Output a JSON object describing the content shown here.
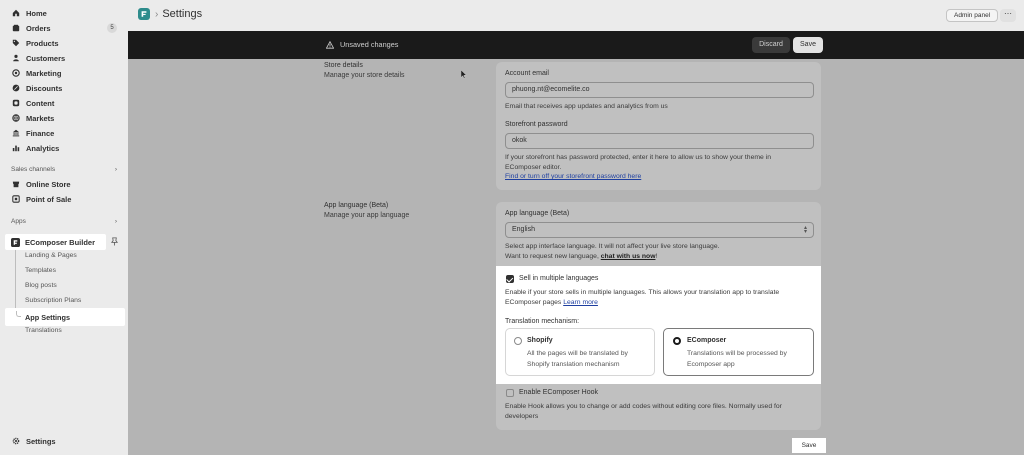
{
  "sidebar": {
    "items": [
      {
        "label": "Home",
        "icon": "home-icon"
      },
      {
        "label": "Orders",
        "icon": "orders-icon",
        "badge": "5"
      },
      {
        "label": "Products",
        "icon": "tag-icon"
      },
      {
        "label": "Customers",
        "icon": "person-icon"
      },
      {
        "label": "Marketing",
        "icon": "target-icon"
      },
      {
        "label": "Discounts",
        "icon": "discount-icon"
      },
      {
        "label": "Content",
        "icon": "content-icon"
      },
      {
        "label": "Markets",
        "icon": "globe-icon"
      },
      {
        "label": "Finance",
        "icon": "bank-icon"
      },
      {
        "label": "Analytics",
        "icon": "chart-icon"
      }
    ],
    "sales_channels_label": "Sales channels",
    "channels": [
      "Online Store",
      "Point of Sale"
    ],
    "apps_label": "Apps",
    "app_name": "EComposer Builder",
    "app_sub_items": [
      "Landing & Pages",
      "Templates",
      "Blog posts",
      "Subscription Plans"
    ],
    "active_sub_item": "App Settings",
    "after_active_sub_item": "Translations",
    "settings_label": "Settings"
  },
  "topbar": {
    "title": "Settings",
    "admin_panel": "Admin panel",
    "more": "⋯"
  },
  "unsaved_bar": {
    "message": "Unsaved changes",
    "discard": "Discard",
    "save": "Save"
  },
  "store_details": {
    "title": "Store details",
    "description": "Manage your store details",
    "account_email_label": "Account email",
    "account_email_value": "phuong.nt@ecomelite.co",
    "account_email_help": "Email that receives app updates and analytics from us",
    "storefront_password_label": "Storefront password",
    "storefront_password_value": "okok",
    "storefront_password_help_1": "If your storefront has password protected, enter it here to allow us to show your theme in",
    "storefront_password_help_2": "EComposer editor.",
    "storefront_password_link": "Find or turn off your storefront password here"
  },
  "app_language": {
    "title": "App language (Beta)",
    "description": "Manage your app language",
    "field_label": "App language (Beta)",
    "selected": "English",
    "help_1": "Select app interface language. It will not affect your live store language.",
    "help_2_prefix": "Want to request new language, ",
    "help_2_link": "chat with us now",
    "help_2_suffix": "!",
    "sell_multiple_label": "Sell in multiple languages",
    "sell_multiple_checked": true,
    "sell_multiple_help_1": "Enable if your store sells in multiple languages. This allows your translation app to translate",
    "sell_multiple_help_2_prefix": "EComposer pages ",
    "sell_multiple_learn_more": "Learn more",
    "mechanism_label": "Translation mechanism:",
    "options": [
      {
        "title": "Shopify",
        "desc_1": "All the pages will be translated by",
        "desc_2": "Shopify translation mechanism",
        "selected": false
      },
      {
        "title": "EComposer",
        "desc_1": "Translations will be processed by",
        "desc_2": "Ecomposer app",
        "selected": true
      }
    ],
    "hook_label": "Enable EComposer Hook",
    "hook_checked": false,
    "hook_help_1": "Enable Hook allows you to change or add codes without editing core files. Normally used for",
    "hook_help_2": "developers"
  },
  "footer": {
    "save": "Save"
  }
}
